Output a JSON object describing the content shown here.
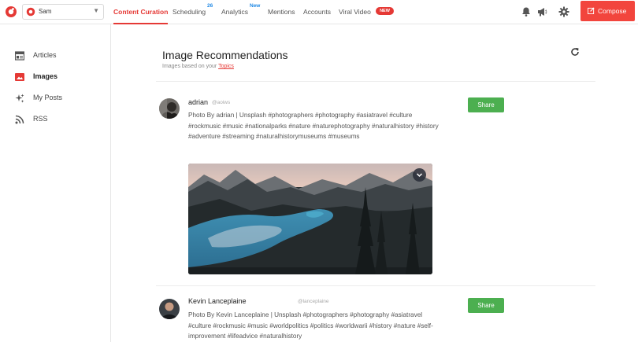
{
  "header": {
    "account_name": "Sam",
    "nav": [
      {
        "label": "Content Curation",
        "active": true
      },
      {
        "label": "Scheduling",
        "badge": "26"
      },
      {
        "label": "Analytics",
        "badge": "New"
      },
      {
        "label": "Mentions"
      },
      {
        "label": "Accounts"
      },
      {
        "label": "Viral Video",
        "tag": "NEW"
      }
    ],
    "icons": [
      "bell-icon",
      "megaphone-icon",
      "gear-icon"
    ],
    "compose_label": "Compose",
    "brand_color": "#e53935",
    "compose_color": "#f2453d"
  },
  "sidebar": {
    "items": [
      {
        "label": "Articles",
        "icon": "articles-icon"
      },
      {
        "label": "Images",
        "icon": "image-icon",
        "active": true
      },
      {
        "label": "My Posts",
        "icon": "sparkle-icon"
      },
      {
        "label": "RSS",
        "icon": "rss-icon"
      }
    ]
  },
  "main": {
    "title": "Image Recommendations",
    "subtitle_prefix": "Images based on your ",
    "subtitle_link": "Topics",
    "posts": [
      {
        "name": "adrian",
        "handle": "@aoiws",
        "text": "Photo By adrian | Unsplash #photographers #photography #asiatravel #culture #rockmusic #music #nationalparks #nature #naturephotography #naturalhistory #history #adventure #streaming #naturalhistorymuseums #museums",
        "share_label": "Share"
      },
      {
        "name": "Kevin Lanceplaine",
        "handle": "@lanceplaine",
        "text": "Photo By Kevin Lanceplaine | Unsplash #photographers #photography #asiatravel #culture #rockmusic #music #worldpolitics #politics #worldwarii #history #nature #self-improvement #lifeadvice #naturalhistory",
        "share_label": "Share"
      }
    ]
  },
  "colors": {
    "share_green": "#4caf50",
    "link_red": "#e53935"
  }
}
